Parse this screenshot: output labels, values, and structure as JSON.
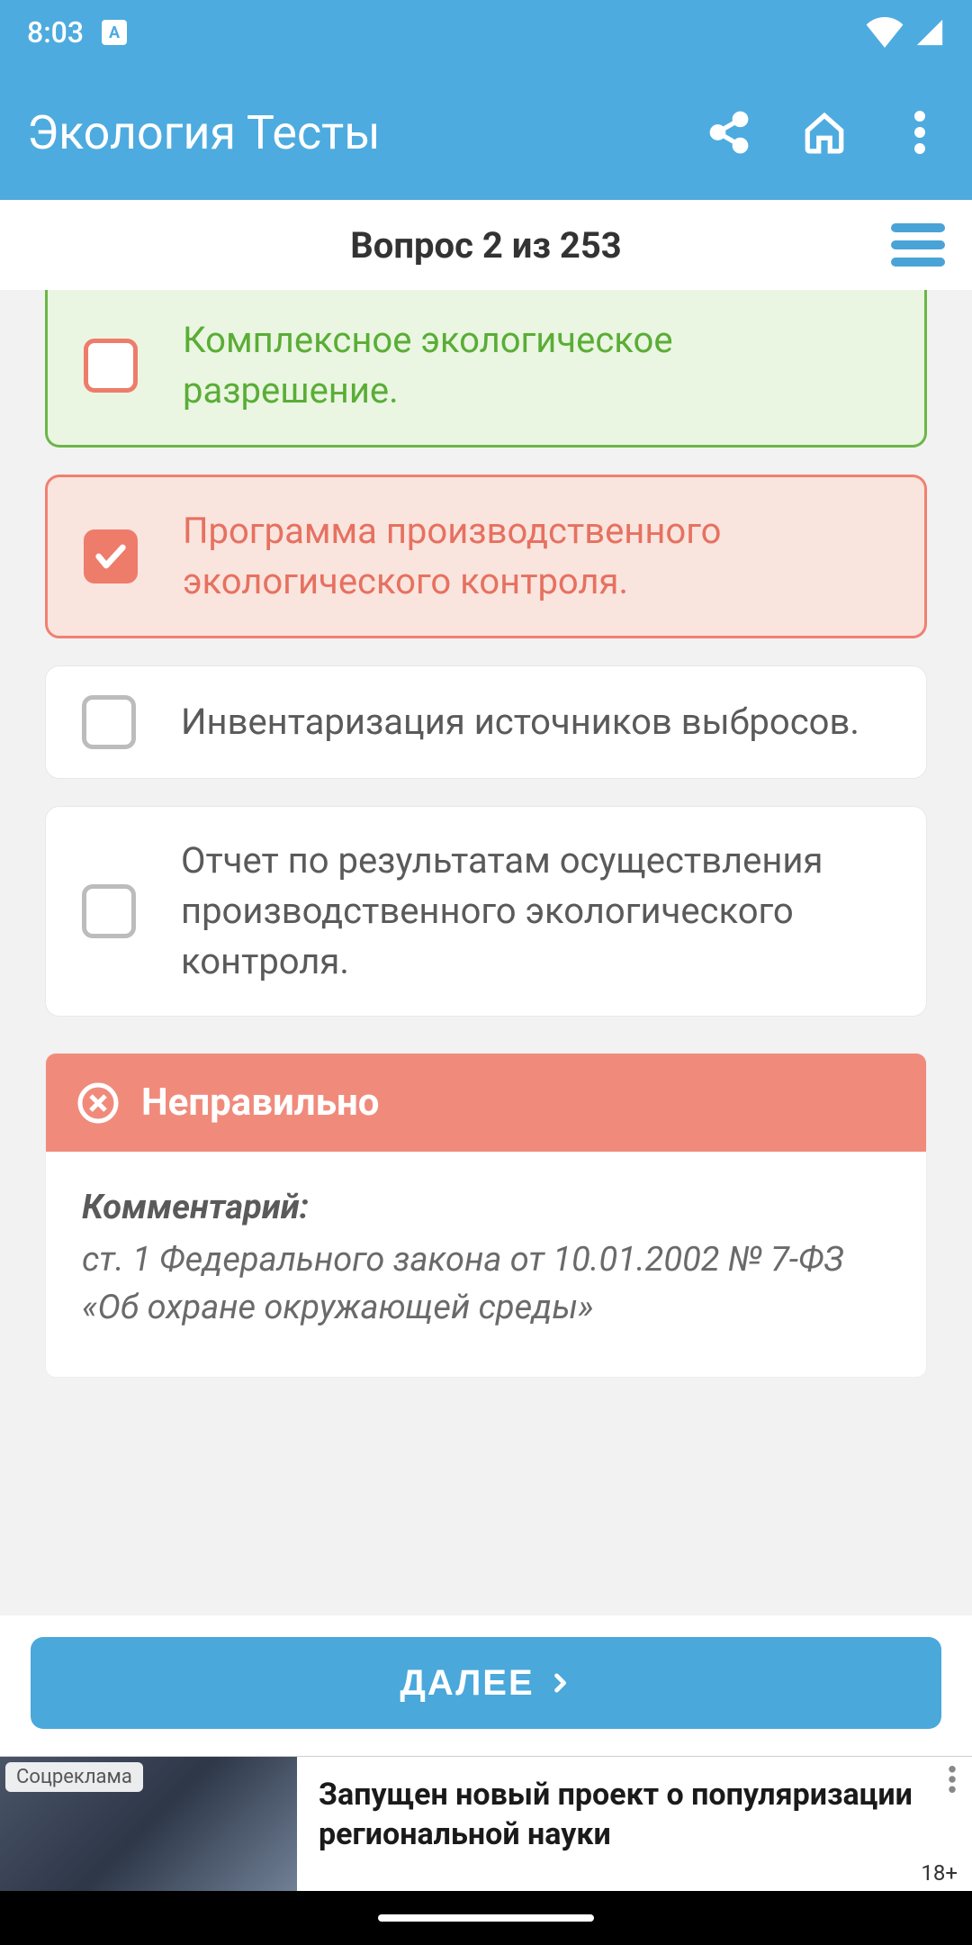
{
  "status": {
    "time": "8:03"
  },
  "appbar": {
    "title": "Экология Тесты"
  },
  "question": {
    "counter": "Вопрос 2 из 253",
    "options": [
      {
        "text": "Комплексное экологическое разрешение."
      },
      {
        "text": "Программа производственного экологического контроля."
      },
      {
        "text": "Инвентаризация источников выбросов."
      },
      {
        "text": "Отчет по результатам осуществления производственного экологического контроля."
      }
    ]
  },
  "feedback": {
    "status": "Неправильно",
    "comment_label": "Комментарий:",
    "comment_text": "ст. 1 Федерального закона от 10.01.2002 № 7-ФЗ «Об охране окружающей среды»"
  },
  "next_label": "ДАЛЕЕ",
  "ad": {
    "badge": "Соцреклама",
    "text": "Запущен новый проект о популяри­зации региональной науки",
    "age": "18+"
  }
}
